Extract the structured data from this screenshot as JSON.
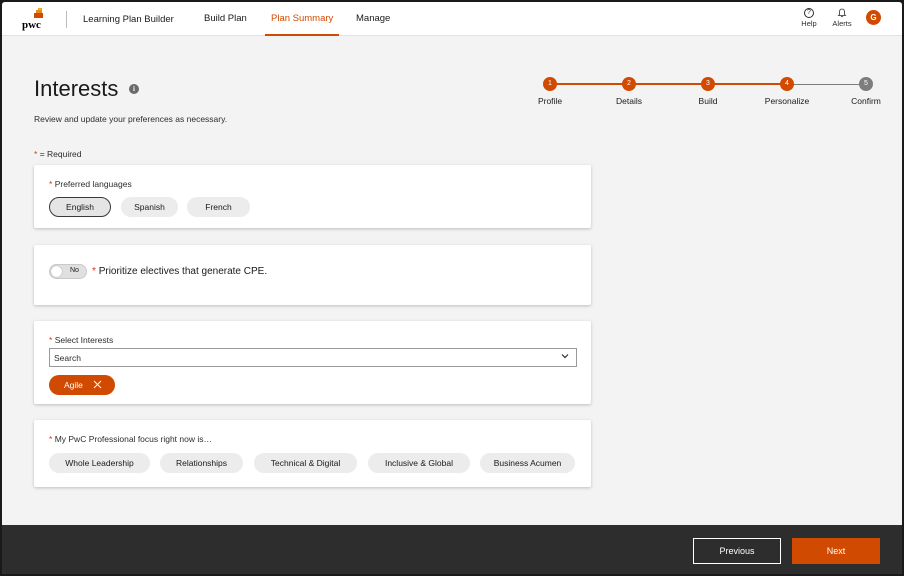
{
  "header": {
    "logo_text": "pwc",
    "app_title": "Learning Plan Builder",
    "tabs": [
      {
        "label": "Build Plan",
        "active": false
      },
      {
        "label": "Plan Summary",
        "active": true
      },
      {
        "label": "Manage",
        "active": false
      }
    ],
    "help_label": "Help",
    "help_glyph": "?",
    "alerts_label": "Alerts",
    "avatar_initial": "G"
  },
  "page": {
    "title": "Interests",
    "subtitle": "Review and update your preferences as necessary.",
    "required_note": "= Required",
    "required_marker": "*"
  },
  "stepper": {
    "steps": [
      {
        "number": "1",
        "label": "Profile",
        "complete": true
      },
      {
        "number": "2",
        "label": "Details",
        "complete": true
      },
      {
        "number": "3",
        "label": "Build",
        "complete": true
      },
      {
        "number": "4",
        "label": "Personalize",
        "complete": true
      },
      {
        "number": "5",
        "label": "Confirm",
        "complete": false
      }
    ]
  },
  "languages": {
    "label": "Preferred languages",
    "options": [
      {
        "label": "English",
        "selected": true
      },
      {
        "label": "Spanish",
        "selected": false
      },
      {
        "label": "French",
        "selected": false
      }
    ]
  },
  "cpe": {
    "toggle_value": "No",
    "label": "Prioritize electives that generate CPE."
  },
  "interests": {
    "label": "Select Interests",
    "search_value": "Search",
    "tags": [
      {
        "label": "Agile"
      }
    ]
  },
  "focus": {
    "label": "My PwC Professional focus right now is…",
    "options": [
      {
        "label": "Whole Leadership"
      },
      {
        "label": "Relationships"
      },
      {
        "label": "Technical & Digital"
      },
      {
        "label": "Inclusive & Global"
      },
      {
        "label": "Business Acumen"
      }
    ]
  },
  "footer": {
    "previous_label": "Previous",
    "next_label": "Next"
  },
  "colors": {
    "accent": "#d04a02",
    "step_incomplete": "#7d7d7d",
    "required_star": "#e0301e",
    "footer_bg": "#2d2d2d"
  }
}
